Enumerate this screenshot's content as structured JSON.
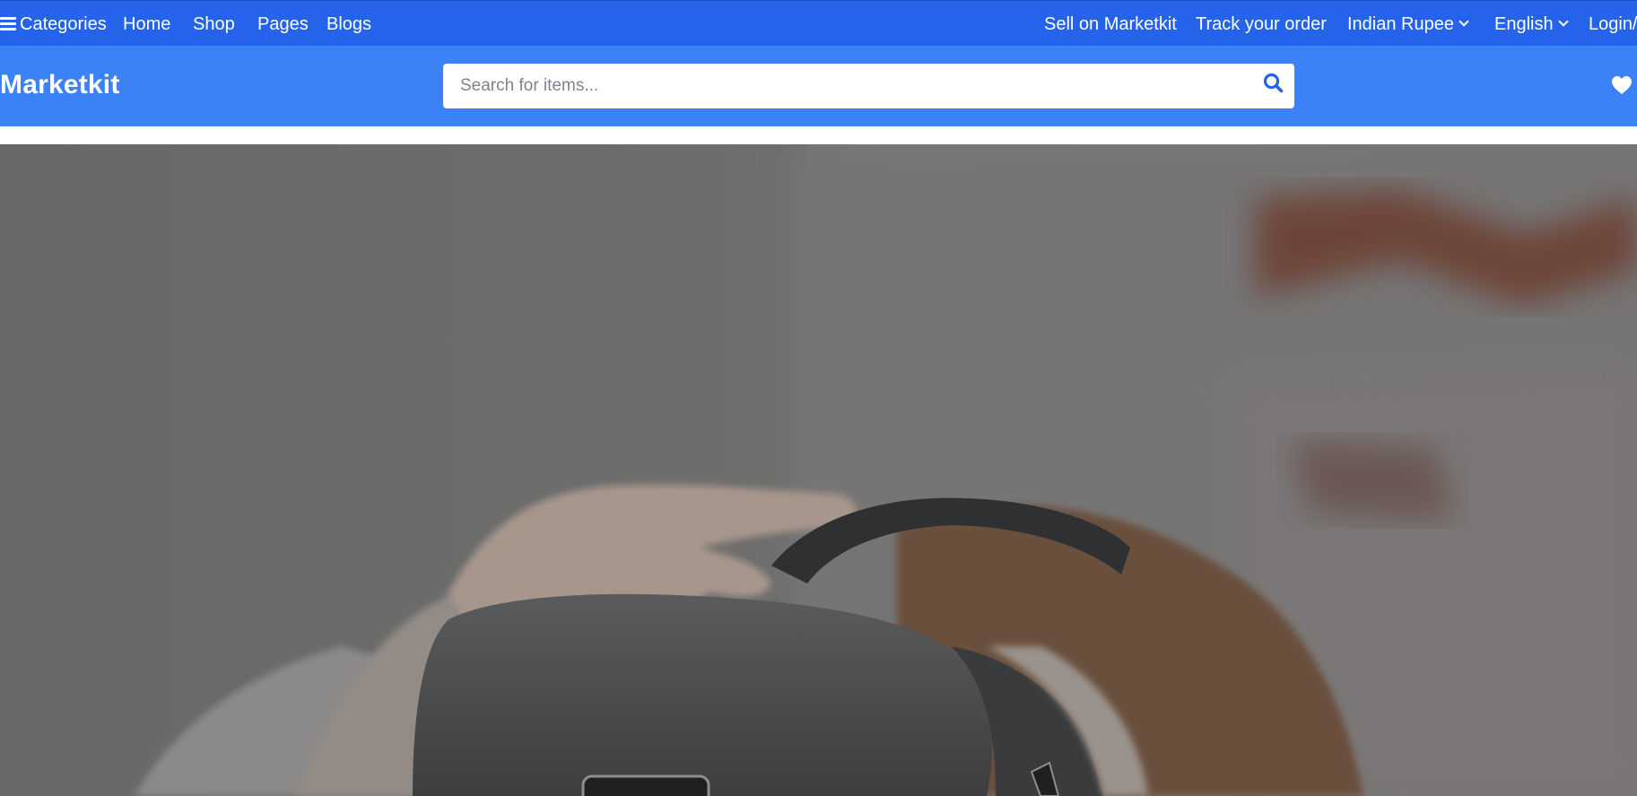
{
  "topnav": {
    "categories_label": "Categories",
    "links": [
      "Home",
      "Shop",
      "Pages",
      "Blogs"
    ],
    "sell_label": "Sell on Marketkit",
    "track_label": "Track your order",
    "currency_label": "Indian Rupee",
    "language_label": "English",
    "login_label": "Login/"
  },
  "header": {
    "brand": "Marketkit",
    "search_placeholder": "Search for items...",
    "search_value": ""
  },
  "icons": {
    "menu": "hamburger-icon",
    "search": "search-icon",
    "wishlist": "heart-icon",
    "dropdown": "chevron-down-icon"
  },
  "colors": {
    "topbar": "#2563eb",
    "midbar": "#3b82f6",
    "text_on_bar": "#ffffff",
    "search_icon": "#2563eb"
  },
  "hero": {
    "image_alt": "Person wearing a VR headset"
  }
}
